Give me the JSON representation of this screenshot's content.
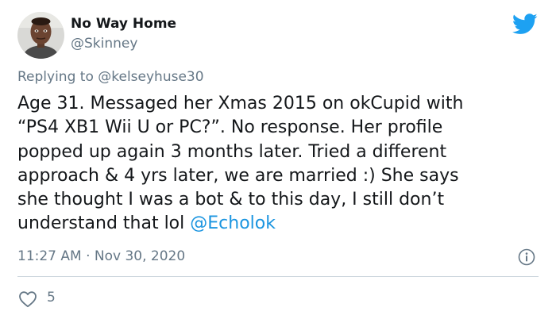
{
  "user": {
    "display_name": "No Way Home",
    "handle": "@Skinney",
    "avatar_icon": "user-avatar"
  },
  "brand_icon": "twitter-bird-icon",
  "reply": {
    "prefix": "Replying to ",
    "to_handle": "@kelseyhuse30"
  },
  "tweet": {
    "text": "Age 31. Messaged her Xmas 2015 on okCupid with\n“PS4 XB1 Wii U or PC?”. No response. Her profile\npopped up again 3 months later. Tried a different\napproach & 4 yrs later, we are married :) She says\nshe thought I was a bot & to this day, I still don’t\nunderstand that lol ",
    "mention": "@Echolok"
  },
  "meta": {
    "timestamp": "11:27 AM · Nov 30, 2020",
    "info_icon": "info-icon"
  },
  "actions": {
    "like_icon": "heart-icon",
    "like_count": "5"
  },
  "colors": {
    "brand": "#1da1f2",
    "link": "#1b95e0",
    "muted": "#657786",
    "text": "#14171a",
    "divider": "#ccd6dd"
  }
}
